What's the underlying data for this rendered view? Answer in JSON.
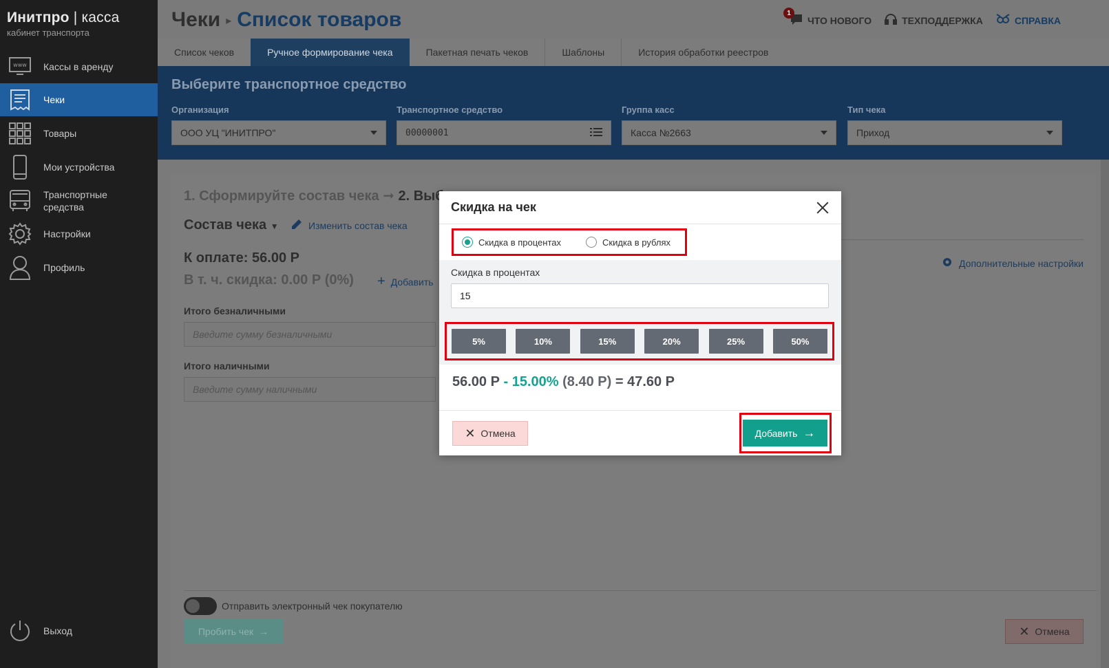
{
  "brand": {
    "name_bold": "Инитпро",
    "name_sep": " | ",
    "name_thin": "касса",
    "subtitle": "кабинет транспорта"
  },
  "sidebar": {
    "items": [
      {
        "label": "Кассы в аренду",
        "icon": "www-monitor-icon"
      },
      {
        "label": "Чеки",
        "icon": "receipt-icon",
        "active": true
      },
      {
        "label": "Товары",
        "icon": "grid-icon"
      },
      {
        "label": "Мои устройства",
        "icon": "phone-icon"
      },
      {
        "label": "Транспортные средства",
        "icon": "bus-icon"
      },
      {
        "label": "Настройки",
        "icon": "gear-icon"
      },
      {
        "label": "Профиль",
        "icon": "user-icon"
      }
    ],
    "logout": "Выход"
  },
  "header": {
    "title": "Чеки",
    "subtitle": "Список товаров",
    "links": {
      "whats_new": "ЧТО НОВОГО",
      "whats_new_badge": "1",
      "support": "ТЕХПОДДЕРЖКА",
      "help": "СПРАВКА"
    }
  },
  "tabs": [
    "Список чеков",
    "Ручное формирование чека",
    "Пакетная печать чеков",
    "Шаблоны",
    "История обработки реестров"
  ],
  "vehicle": {
    "title": "Выберите транспортное средство",
    "org_label": "Организация",
    "org_value": "ООО УЦ \"ИНИТПРО\"",
    "vehicle_label": "Транспортное средство",
    "vehicle_value": "00000001",
    "group_label": "Группа касс",
    "group_value": "Касса №2663",
    "type_label": "Тип чека",
    "type_value": "Приход"
  },
  "card": {
    "step1": "1. Сформируйте состав чека",
    "step2": "2. Выб",
    "sostav": "Состав чека",
    "edit": "Изменить состав чека",
    "pay": "К оплате: 56.00 Р",
    "discount": "В т. ч. скидка: 0.00 Р (0%)",
    "add": "Добавить",
    "extra_settings": "Дополнительные настройки",
    "cashless_label": "Итого безналичными",
    "cashless_placeholder": "Введите сумму безналичными",
    "cash_label": "Итого наличными",
    "cash_placeholder": "Введите сумму наличными",
    "send_email": "Отправить электронный чек покупателю",
    "punch": "Пробить чек",
    "cancel": "Отмена"
  },
  "modal": {
    "title": "Скидка на чек",
    "radio_percent": "Скидка в процентах",
    "radio_rub": "Скидка в рублях",
    "input_label": "Скидка в процентах",
    "input_value": "15",
    "presets": [
      "5%",
      "10%",
      "15%",
      "20%",
      "25%",
      "50%"
    ],
    "calc_base": "56.00 Р",
    "calc_minus": " - ",
    "calc_pct": "15.00%",
    "calc_amount": " (8.40 Р)",
    "calc_result": " = 47.60 Р",
    "cancel": "Отмена",
    "add": "Добавить"
  },
  "colors": {
    "accent": "#12a08c",
    "active_nav": "#1f5e9f",
    "highlight": "#e0000f",
    "band": "#1f5e9f"
  }
}
